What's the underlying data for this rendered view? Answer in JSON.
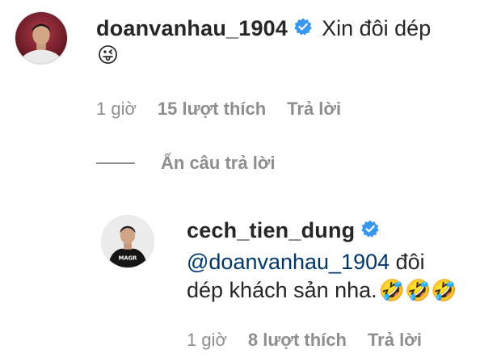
{
  "comment": {
    "username": "doanvanhau_1904",
    "text": "Xin đôi dép",
    "emoji": "😜",
    "time": "1 giờ",
    "likes": "15 lượt thích",
    "reply_label": "Trả lời"
  },
  "hide_replies_label": "Ẩn câu trả lời",
  "reply": {
    "username": "cech_tien_dung",
    "mention": "@doanvanhau_1904",
    "text_line1_tail": " đôi",
    "text_line2": "dép khách sản nha.",
    "emoji": "🤣🤣🤣",
    "time": "1 giờ",
    "likes": "8 lượt thích",
    "reply_label": "Trả lời"
  },
  "colors": {
    "verified_badge": "#3897f0",
    "meta_text": "#8e8e8e",
    "mention_link": "#00376b"
  }
}
